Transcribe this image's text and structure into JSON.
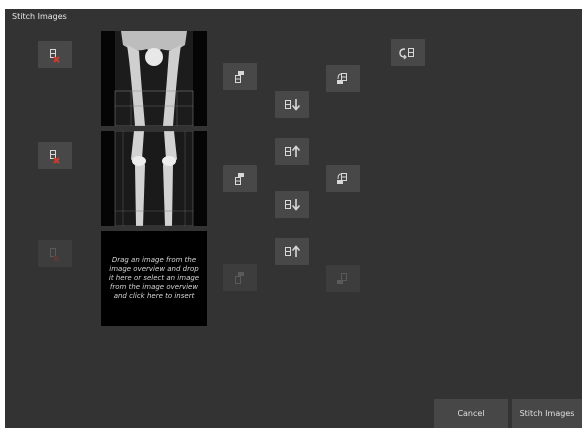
{
  "window": {
    "title": "Stitch Images"
  },
  "placeholder": {
    "text": "Drag an image from the image overview and drop it here or select an image from the image overview and click here to insert"
  },
  "footer": {
    "cancel_label": "Cancel",
    "stitch_label": "Stitch Images"
  },
  "icons": {
    "remove": "delete-image-icon",
    "flip_down": "flip-icon",
    "flip_up": "flip-icon",
    "move_down": "move-down-icon",
    "move_up": "move-up-icon",
    "rotate": "rotate-icon"
  },
  "colors": {
    "window_bg": "#333333",
    "button_bg": "#484848",
    "delete_x": "#d03a2a",
    "icon": "#d8d8d8"
  }
}
